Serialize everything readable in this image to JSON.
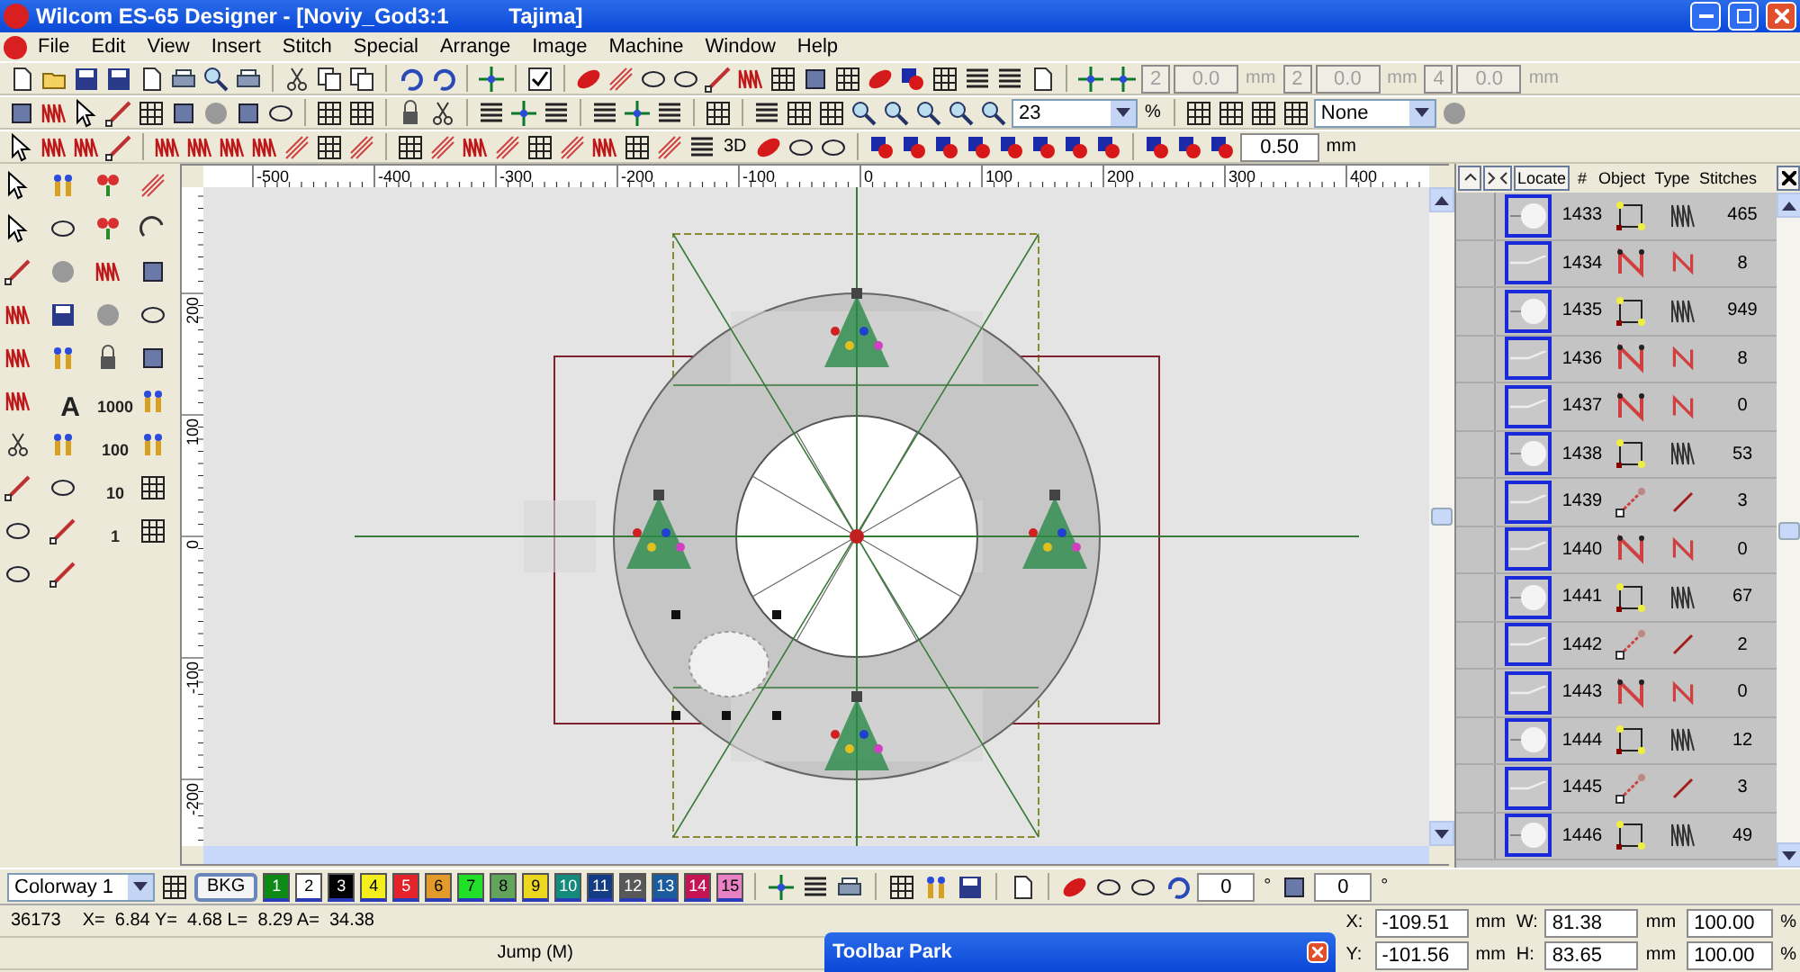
{
  "window": {
    "title": "Wilcom ES-65 Designer - [Noviy_God3:1          Tajima]"
  },
  "menu": [
    "File",
    "Edit",
    "View",
    "Insert",
    "Stitch",
    "Special",
    "Arrange",
    "Image",
    "Machine",
    "Window",
    "Help"
  ],
  "toolbar_1": {
    "fields": [
      {
        "value": "2",
        "disabled": true
      },
      {
        "value": "0.0",
        "unit": "mm",
        "disabled": true
      },
      {
        "value": "2",
        "disabled": true
      },
      {
        "value": "0.0",
        "unit": "mm",
        "disabled": true
      },
      {
        "value": "4",
        "disabled": true
      },
      {
        "value": "0.0",
        "unit": "mm",
        "disabled": true
      }
    ]
  },
  "toolbar_2": {
    "zoom": "23",
    "zoom_unit": "%",
    "color_select": "None"
  },
  "toolbar_3": {
    "label_3d": "3D",
    "spacing": "0.50",
    "spacing_unit": "mm"
  },
  "toolbox": {
    "text_tools": [
      "A",
      "1000",
      "100",
      "10",
      "1"
    ]
  },
  "ruler": {
    "horizontal": [
      "-500",
      "-400",
      "-300",
      "-200",
      "-100",
      "0",
      "100",
      "200",
      "300",
      "400"
    ],
    "vertical": [
      "200",
      "100",
      "0",
      "-100",
      "-200"
    ]
  },
  "sequence_panel": {
    "locate": "Locate",
    "columns": [
      "#",
      "Object",
      "Type",
      "Stitches"
    ],
    "rows": [
      {
        "number": "1433",
        "kind": "fill",
        "stitches": "465"
      },
      {
        "number": "1434",
        "kind": "run",
        "stitches": "8"
      },
      {
        "number": "1435",
        "kind": "fill",
        "stitches": "949"
      },
      {
        "number": "1436",
        "kind": "run",
        "stitches": "8"
      },
      {
        "number": "1437",
        "kind": "run",
        "stitches": "0"
      },
      {
        "number": "1438",
        "kind": "fill",
        "stitches": "53"
      },
      {
        "number": "1439",
        "kind": "single",
        "stitches": "3"
      },
      {
        "number": "1440",
        "kind": "run",
        "stitches": "0"
      },
      {
        "number": "1441",
        "kind": "fill",
        "stitches": "67"
      },
      {
        "number": "1442",
        "kind": "single",
        "stitches": "2"
      },
      {
        "number": "1443",
        "kind": "run",
        "stitches": "0"
      },
      {
        "number": "1444",
        "kind": "fill",
        "stitches": "12"
      },
      {
        "number": "1445",
        "kind": "single",
        "stitches": "3"
      },
      {
        "number": "1446",
        "kind": "fill",
        "stitches": "49"
      }
    ]
  },
  "colorbar": {
    "colorway": "Colorway 1",
    "background": "BKG",
    "swatches": [
      {
        "label": "1",
        "color": "#0c8a14"
      },
      {
        "label": "2",
        "color": "#ffffff"
      },
      {
        "label": "3",
        "color": "#000000"
      },
      {
        "label": "4",
        "color": "#f4ee1c"
      },
      {
        "label": "5",
        "color": "#e4222a"
      },
      {
        "label": "6",
        "color": "#e49a2a"
      },
      {
        "label": "7",
        "color": "#22e02a"
      },
      {
        "label": "8",
        "color": "#62a45a"
      },
      {
        "label": "9",
        "color": "#ecd81e"
      },
      {
        "label": "10",
        "color": "#148a7c"
      },
      {
        "label": "11",
        "color": "#133c84"
      },
      {
        "label": "12",
        "color": "#585858"
      },
      {
        "label": "13",
        "color": "#1a5c9e"
      },
      {
        "label": "14",
        "color": "#c41452"
      },
      {
        "label": "15",
        "color": "#e882c4"
      }
    ],
    "rotate": "0",
    "rotate_unit": "°",
    "slant": "0",
    "slant_unit": "°"
  },
  "status_bar": {
    "count": "36173",
    "coords": "X=  6.84 Y=  4.68 L=  8.29 A=  34.38",
    "stitch_type": "Jump (M)"
  },
  "toolbar_park": {
    "title": "Toolbar Park"
  },
  "transform": [
    {
      "label": "X:",
      "value": "-109.51",
      "unit": "mm"
    },
    {
      "label": "W:",
      "value": "81.38",
      "unit": "mm"
    },
    {
      "value": "100.00",
      "unit": "%"
    },
    {
      "label": "Y:",
      "value": "-101.56",
      "unit": "mm"
    },
    {
      "label": "H:",
      "value": "83.65",
      "unit": "mm"
    },
    {
      "value": "100.00",
      "unit": "%"
    }
  ]
}
